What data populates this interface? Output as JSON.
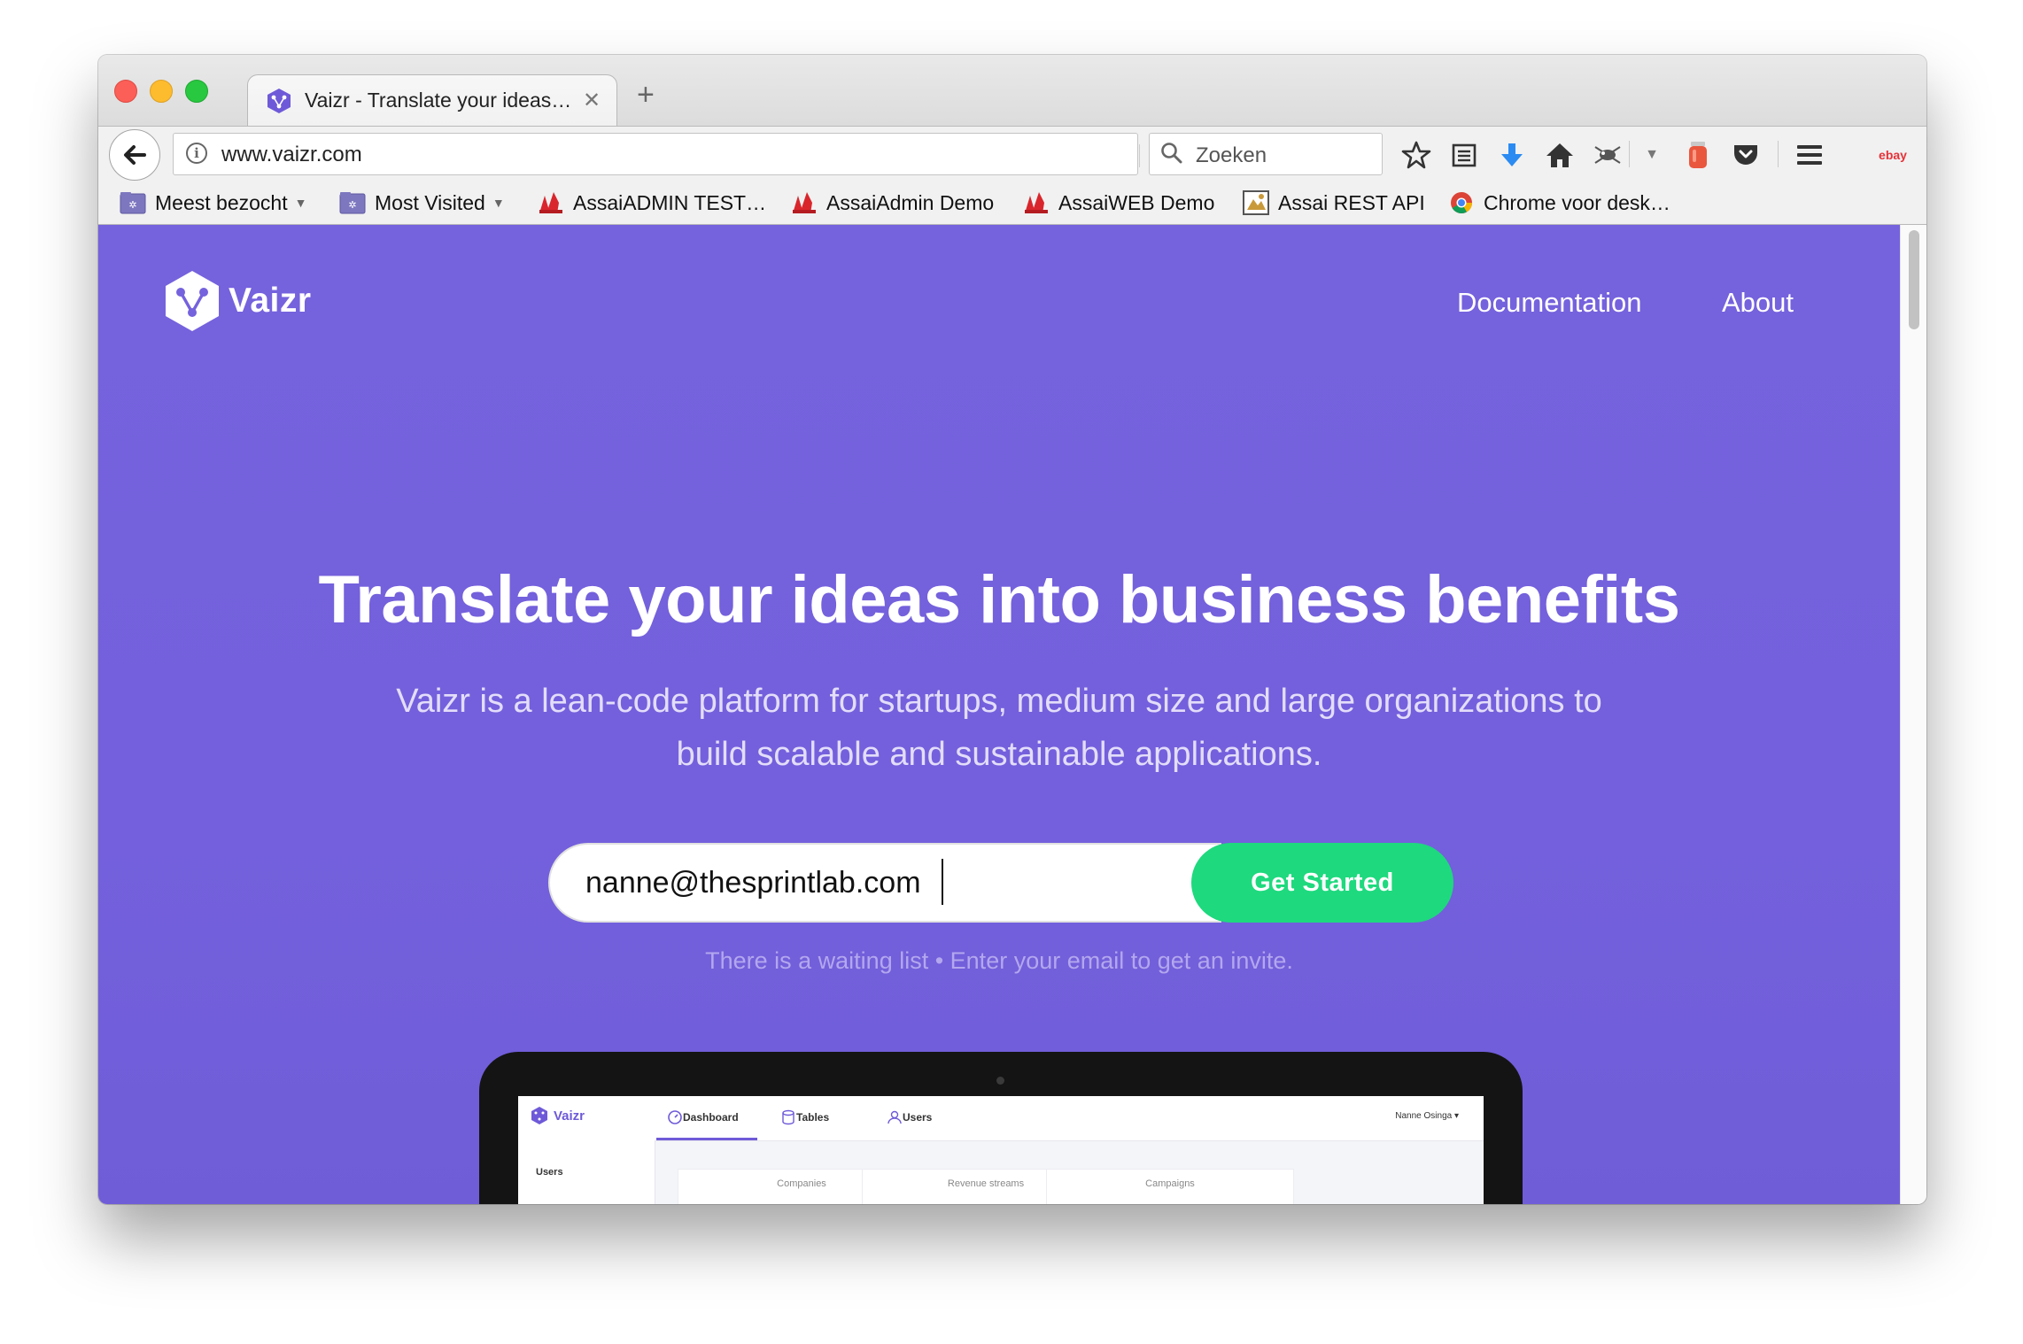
{
  "browser": {
    "tab_title": "Vaizr - Translate your ideas…",
    "tab_close": "✕",
    "new_tab": "+",
    "url": "www.vaizr.com",
    "search_placeholder": "Zoeken",
    "toolbar_icons": [
      "star-icon",
      "reading-list-icon",
      "download-icon",
      "home-icon",
      "extension-icon",
      "dropdown-icon",
      "extension-jar-icon",
      "pocket-icon",
      "menu-icon",
      "ebay-icon"
    ],
    "ebay_label": "ebay"
  },
  "bookmarks": [
    {
      "label": "Meest bezocht",
      "dropdown": true,
      "icon": "folder-icon"
    },
    {
      "label": "Most Visited",
      "dropdown": true,
      "icon": "folder-icon"
    },
    {
      "label": "AssaiADMIN TEST…",
      "icon": "assai-icon"
    },
    {
      "label": "AssaiAdmin Demo",
      "icon": "assai-icon"
    },
    {
      "label": "AssaiWEB Demo",
      "icon": "assai-icon"
    },
    {
      "label": "Assai REST API",
      "icon": "api-icon"
    },
    {
      "label": "Chrome voor desk…",
      "icon": "chrome-icon"
    }
  ],
  "site": {
    "brand": "Vaizr",
    "nav": {
      "documentation": "Documentation",
      "about": "About"
    },
    "hero_title": "Translate your ideas into business benefits",
    "hero_subtitle": "Vaizr is a lean-code platform for startups, medium size and large organizations to build scalable and sustainable applications.",
    "email_value": "nanne@thesprintlab.com",
    "cta_label": "Get Started",
    "hint": "There is a waiting list • Enter your email to get an invite."
  },
  "mockup": {
    "brand": "Vaizr",
    "tabs": [
      "Dashboard",
      "Tables",
      "Users"
    ],
    "user": "Nanne Osinga ▾",
    "sidebar_label": "Users",
    "cards": [
      "Companies",
      "Revenue streams",
      "Campaigns"
    ]
  },
  "colors": {
    "page_bg": "#7562dd",
    "cta_bg": "#1ed97e",
    "brand_purple": "#6e5ad8"
  }
}
